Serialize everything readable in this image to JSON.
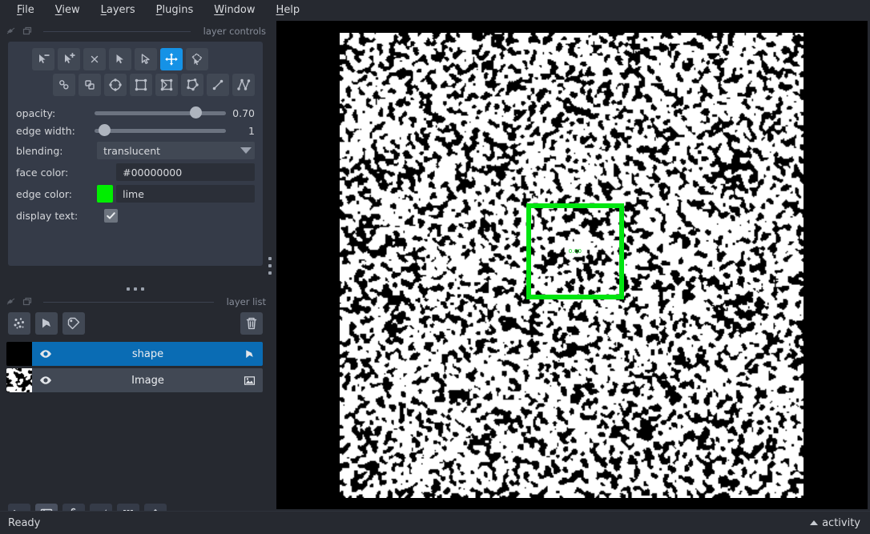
{
  "app": {
    "status_text": "Ready",
    "activity_label": "activity",
    "accent_blue": "#0a6cb4",
    "active_tool_blue": "#1592e6",
    "panel_bg": "#353b48",
    "window_bg": "#262930"
  },
  "menubar": {
    "items": [
      {
        "label": "File",
        "mnemonic": "F"
      },
      {
        "label": "View",
        "mnemonic": "V"
      },
      {
        "label": "Layers",
        "mnemonic": "L"
      },
      {
        "label": "Plugins",
        "mnemonic": "P"
      },
      {
        "label": "Window",
        "mnemonic": "W"
      },
      {
        "label": "Help",
        "mnemonic": "H"
      }
    ]
  },
  "layer_controls": {
    "dock_title": "layer controls",
    "tools_row1": [
      {
        "name": "vertex-remove-icon",
        "active": false
      },
      {
        "name": "vertex-insert-icon",
        "active": false
      },
      {
        "name": "delete-shape-icon",
        "active": false
      },
      {
        "name": "select-filled-icon",
        "active": false
      },
      {
        "name": "select-outline-icon",
        "active": false
      },
      {
        "name": "pan-zoom-icon",
        "active": true
      },
      {
        "name": "transform-icon",
        "active": false
      }
    ],
    "tools_row2": [
      {
        "name": "move-front-icon",
        "active": false
      },
      {
        "name": "move-back-icon",
        "active": false
      },
      {
        "name": "ellipse-icon",
        "active": false
      },
      {
        "name": "rectangle-icon",
        "active": false
      },
      {
        "name": "polygon-icon",
        "active": false
      },
      {
        "name": "polygon-lasso-icon",
        "active": false
      },
      {
        "name": "line-icon",
        "active": false
      },
      {
        "name": "path-icon",
        "active": false
      }
    ],
    "opacity": {
      "label": "opacity:",
      "value": "0.70",
      "percent": 70
    },
    "edge_width": {
      "label": "edge width:",
      "value": "1",
      "percent": 3
    },
    "blending": {
      "label": "blending:",
      "value": "translucent"
    },
    "face_color": {
      "label": "face color:",
      "value": "#00000000",
      "swatch": "#00000000"
    },
    "edge_color": {
      "label": "edge color:",
      "value": "lime",
      "swatch": "#00ee00"
    },
    "display_text": {
      "label": "display text:",
      "checked": true
    }
  },
  "layer_list": {
    "dock_title": "layer list",
    "buttons": [
      {
        "name": "new-points-layer-button"
      },
      {
        "name": "new-shapes-layer-button"
      },
      {
        "name": "new-labels-layer-button"
      },
      {
        "name": "delete-layer-button"
      }
    ],
    "layers": [
      {
        "name": "shape",
        "type": "shapes",
        "selected": true,
        "visible": true,
        "thumbnail": "black"
      },
      {
        "name": "Image",
        "type": "image",
        "selected": false,
        "visible": true,
        "thumbnail": "noise"
      }
    ]
  },
  "viewer_buttons": [
    {
      "name": "console-button"
    },
    {
      "name": "ndisplay-toggle-button"
    },
    {
      "name": "roll-dimensions-button"
    },
    {
      "name": "transpose-dimensions-button"
    },
    {
      "name": "grid-view-button"
    },
    {
      "name": "reset-view-home-button"
    }
  ],
  "canvas": {
    "background": "#000000",
    "image_layer": {
      "name": "Image",
      "kind": "binary-noise"
    },
    "shape": {
      "kind": "rectangle",
      "edge_color": "#00e510",
      "face_color": "#00000000",
      "edge_width": 6,
      "text_label": "0.00"
    }
  }
}
